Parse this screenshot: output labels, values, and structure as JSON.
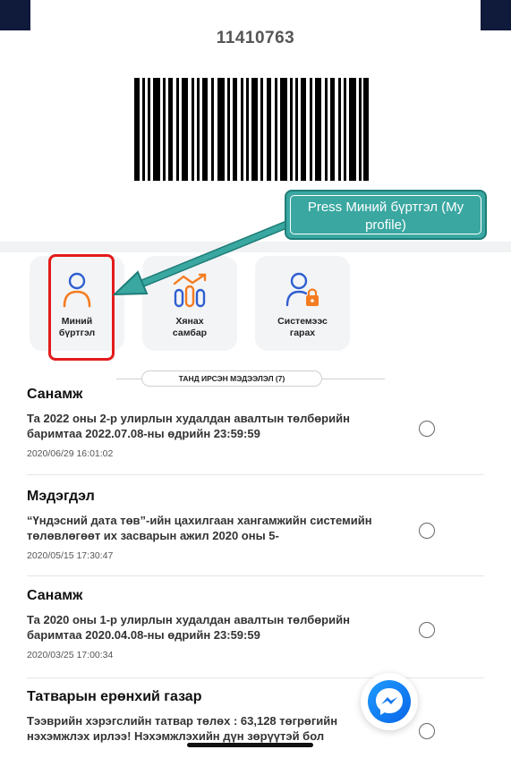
{
  "card": {
    "user_number": "11410763"
  },
  "tiles": [
    {
      "id": "profile",
      "label_line1": "Миний",
      "label_line2": "бүртгэл",
      "icon": "user-icon"
    },
    {
      "id": "dashboard",
      "label_line1": "Хянах",
      "label_line2": "самбар",
      "icon": "dashboard-chart-icon"
    },
    {
      "id": "logout",
      "label_line1": "Системээс",
      "label_line2": "гарах",
      "icon": "user-lock-icon"
    }
  ],
  "callout": {
    "prefix": "Press ",
    "highlight": "Миний бүртгэл",
    "suffix": " (My profile)"
  },
  "inbox": {
    "label": "ТАНД ИРСЭН МЭДЭЭЛЭЛ (7)"
  },
  "messages": [
    {
      "title": "Санамж",
      "body": "Та 2022 оны 2-р улирлын худалдан авалтын төлбөрийн баримтаа 2022.07.08-ны өдрийн 23:59:59",
      "time": "2020/06/29 16:01:02"
    },
    {
      "title": "Мэдэгдэл",
      "body": "“Үндэсний дата төв”-ийн цахилгаан хангамжийн системийн төлөвлөгөөт их засварын ажил 2020 оны 5-",
      "time": "2020/05/15 17:30:47"
    },
    {
      "title": "Санамж",
      "body": "Та 2020 оны 1-р улирлын худалдан авалтын төлбөрийн баримтаа 2020.04.08-ны өдрийн 23:59:59",
      "time": "2020/03/25 17:00:34"
    },
    {
      "title": "Татварын ерөнхий газар",
      "body": "Тээврийн хэрэгслийн татвар төлөх : 63,128 төгрөгийн нэхэмжлэх ирлээ! Нэхэмжлэхийн дүн зөрүүтэй бол",
      "time": ""
    }
  ],
  "colors": {
    "accent_orange": "#f47c20",
    "accent_blue": "#2f5fd0",
    "highlight_red": "#e41b1b",
    "callout_teal": "#3aa7a1"
  }
}
